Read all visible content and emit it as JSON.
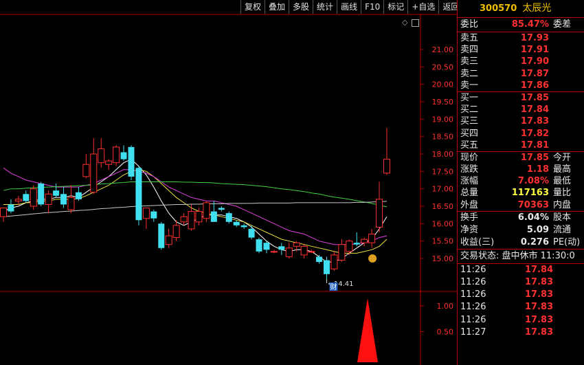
{
  "toolbar": [
    "复权",
    "叠加",
    "多股",
    "统计",
    "画线",
    "F10",
    "标记",
    "+自选",
    "返回"
  ],
  "stock": {
    "code": "300570",
    "name": "太辰光"
  },
  "quote_rows": [
    {
      "label": "委比",
      "value": "85.47%",
      "color": "red",
      "label2": "委差"
    }
  ],
  "ask_rows": [
    {
      "label": "卖五",
      "value": "17.93"
    },
    {
      "label": "卖四",
      "value": "17.91"
    },
    {
      "label": "卖三",
      "value": "17.90"
    },
    {
      "label": "卖二",
      "value": "17.87"
    },
    {
      "label": "卖一",
      "value": "17.86"
    }
  ],
  "bid_rows": [
    {
      "label": "买一",
      "value": "17.85"
    },
    {
      "label": "买二",
      "value": "17.84"
    },
    {
      "label": "买三",
      "value": "17.83"
    },
    {
      "label": "买四",
      "value": "17.82"
    },
    {
      "label": "买五",
      "value": "17.81"
    }
  ],
  "stats_rows": [
    {
      "label": "现价",
      "value": "17.85",
      "color": "red",
      "label2": "今开"
    },
    {
      "label": "涨跌",
      "value": "1.18",
      "color": "red",
      "label2": "最高"
    },
    {
      "label": "涨幅",
      "value": "7.08%",
      "color": "red",
      "label2": "最低"
    },
    {
      "label": "总量",
      "value": "117163",
      "color": "yel",
      "label2": "量比"
    },
    {
      "label": "外盘",
      "value": "70363",
      "color": "red",
      "label2": "内盘"
    }
  ],
  "fin_rows": [
    {
      "label": "换手",
      "value": "6.04%",
      "color": "wht",
      "label2": "股本"
    },
    {
      "label": "净资",
      "value": "5.09",
      "color": "wht",
      "label2": "流通"
    },
    {
      "label": "收益(三)",
      "value": "0.276",
      "color": "wht",
      "label2": "PE(动)"
    }
  ],
  "trade_status": "交易状态: 盘中休市 11:30:0",
  "ticks": [
    {
      "time": "11:26",
      "price": "17.84"
    },
    {
      "time": "11:26",
      "price": "17.83"
    },
    {
      "time": "11:26",
      "price": "17.83"
    },
    {
      "time": "11:26",
      "price": "17.83"
    },
    {
      "time": "11:26",
      "price": "17.83"
    },
    {
      "time": "11:27",
      "price": "17.83"
    }
  ],
  "chart_data": {
    "type": "candlestick",
    "price_axis_ticks": [
      "21.00",
      "20.50",
      "20.00",
      "19.50",
      "19.00",
      "18.50",
      "18.00",
      "17.50",
      "17.00",
      "16.50",
      "16.00",
      "15.50",
      "15.00"
    ],
    "price_range": [
      14.3,
      21.6
    ],
    "volume_axis_ticks": [
      "1.00",
      "0.50"
    ],
    "low_marker": "14.41",
    "finance_badge": "财",
    "candles": [
      {
        "o": 16.2,
        "h": 16.45,
        "l": 16.05,
        "c": 16.45
      },
      {
        "o": 16.55,
        "h": 16.7,
        "l": 16.3,
        "c": 16.35
      },
      {
        "o": 16.65,
        "h": 16.8,
        "l": 16.55,
        "c": 16.7
      },
      {
        "o": 16.85,
        "h": 16.95,
        "l": 16.6,
        "c": 16.65
      },
      {
        "o": 16.5,
        "h": 17.1,
        "l": 16.4,
        "c": 17.0
      },
      {
        "o": 17.15,
        "h": 17.2,
        "l": 16.5,
        "c": 16.55
      },
      {
        "o": 16.55,
        "h": 16.95,
        "l": 16.3,
        "c": 16.85
      },
      {
        "o": 16.95,
        "h": 17.15,
        "l": 16.75,
        "c": 16.8
      },
      {
        "o": 16.85,
        "h": 17.05,
        "l": 16.45,
        "c": 16.55
      },
      {
        "o": 16.4,
        "h": 17.1,
        "l": 16.3,
        "c": 16.75
      },
      {
        "o": 16.9,
        "h": 17.05,
        "l": 16.65,
        "c": 16.7
      },
      {
        "o": 17.35,
        "h": 18.0,
        "l": 17.3,
        "c": 17.7
      },
      {
        "o": 16.9,
        "h": 18.45,
        "l": 16.85,
        "c": 18.0
      },
      {
        "o": 17.75,
        "h": 18.45,
        "l": 17.6,
        "c": 18.15
      },
      {
        "o": 17.7,
        "h": 17.85,
        "l": 17.55,
        "c": 17.8
      },
      {
        "o": 17.75,
        "h": 18.25,
        "l": 17.65,
        "c": 18.2
      },
      {
        "o": 18.05,
        "h": 18.25,
        "l": 17.8,
        "c": 17.85
      },
      {
        "o": 18.2,
        "h": 18.25,
        "l": 17.25,
        "c": 17.35
      },
      {
        "o": 17.6,
        "h": 17.65,
        "l": 15.95,
        "c": 16.1
      },
      {
        "o": 16.15,
        "h": 16.45,
        "l": 15.85,
        "c": 16.45
      },
      {
        "o": 16.35,
        "h": 16.4,
        "l": 16.05,
        "c": 16.15
      },
      {
        "o": 16.0,
        "h": 16.05,
        "l": 15.25,
        "c": 15.3
      },
      {
        "o": 15.4,
        "h": 15.85,
        "l": 15.3,
        "c": 15.65
      },
      {
        "o": 15.6,
        "h": 16.1,
        "l": 15.5,
        "c": 15.95
      },
      {
        "o": 16.05,
        "h": 16.3,
        "l": 15.95,
        "c": 16.2
      },
      {
        "o": 15.85,
        "h": 16.55,
        "l": 15.8,
        "c": 16.35
      },
      {
        "o": 16.05,
        "h": 16.45,
        "l": 15.95,
        "c": 16.35
      },
      {
        "o": 16.15,
        "h": 16.65,
        "l": 16.05,
        "c": 16.6
      },
      {
        "o": 16.35,
        "h": 16.65,
        "l": 16.25,
        "c": 16.05
      },
      {
        "o": 16.45,
        "h": 16.5,
        "l": 16.35,
        "c": 16.4
      },
      {
        "o": 16.3,
        "h": 16.35,
        "l": 16.0,
        "c": 16.05
      },
      {
        "o": 16.05,
        "h": 16.1,
        "l": 15.9,
        "c": 15.95
      },
      {
        "o": 15.95,
        "h": 16.0,
        "l": 15.85,
        "c": 15.9
      },
      {
        "o": 15.85,
        "h": 15.95,
        "l": 15.55,
        "c": 15.6
      },
      {
        "o": 15.55,
        "h": 15.6,
        "l": 15.15,
        "c": 15.2
      },
      {
        "o": 15.45,
        "h": 15.5,
        "l": 15.15,
        "c": 15.25
      },
      {
        "o": 15.2,
        "h": 15.25,
        "l": 15.15,
        "c": 15.2
      },
      {
        "o": 15.35,
        "h": 15.45,
        "l": 15.1,
        "c": 15.25
      },
      {
        "o": 15.05,
        "h": 15.45,
        "l": 15.0,
        "c": 15.3
      },
      {
        "o": 15.35,
        "h": 15.5,
        "l": 15.2,
        "c": 15.45
      },
      {
        "o": 15.1,
        "h": 15.4,
        "l": 15.0,
        "c": 15.35
      },
      {
        "o": 15.2,
        "h": 15.25,
        "l": 15.15,
        "c": 15.2
      },
      {
        "o": 15.05,
        "h": 15.1,
        "l": 14.85,
        "c": 14.9
      },
      {
        "o": 14.95,
        "h": 15.05,
        "l": 14.41,
        "c": 14.55
      },
      {
        "o": 14.7,
        "h": 15.2,
        "l": 14.65,
        "c": 15.1
      },
      {
        "o": 14.95,
        "h": 15.55,
        "l": 14.9,
        "c": 15.4
      },
      {
        "o": 15.2,
        "h": 15.55,
        "l": 15.1,
        "c": 15.5
      },
      {
        "o": 15.45,
        "h": 15.75,
        "l": 15.35,
        "c": 15.4
      },
      {
        "o": 15.45,
        "h": 15.6,
        "l": 15.35,
        "c": 15.55
      },
      {
        "o": 15.45,
        "h": 15.85,
        "l": 15.3,
        "c": 15.7
      },
      {
        "o": 15.9,
        "h": 17.2,
        "l": 15.75,
        "c": 16.7
      },
      {
        "o": 17.45,
        "h": 18.75,
        "l": 17.4,
        "c": 17.85
      }
    ],
    "ma_series": [
      {
        "color": "#ffffff",
        "values": [
          16.35,
          16.45,
          16.5,
          16.6,
          16.65,
          16.7,
          16.7,
          16.75,
          16.75,
          16.8,
          16.75,
          16.9,
          17.05,
          17.2,
          17.35,
          17.55,
          17.75,
          17.85,
          17.65,
          17.4,
          17.05,
          16.65,
          16.3,
          16.05,
          15.95,
          16.05,
          16.15,
          16.25,
          16.25,
          16.25,
          16.2,
          16.15,
          16.05,
          15.9,
          15.7,
          15.5,
          15.35,
          15.25,
          15.2,
          15.25,
          15.25,
          15.2,
          15.05,
          14.9,
          14.9,
          15.0,
          15.15,
          15.3,
          15.45,
          15.55,
          15.85,
          16.2
        ]
      },
      {
        "color": "#f0e040",
        "values": [
          16.55,
          16.55,
          16.55,
          16.6,
          16.6,
          16.65,
          16.65,
          16.7,
          16.7,
          16.7,
          16.72,
          16.8,
          16.9,
          17.0,
          17.1,
          17.25,
          17.4,
          17.5,
          17.55,
          17.5,
          17.35,
          17.15,
          16.95,
          16.75,
          16.6,
          16.45,
          16.35,
          16.3,
          16.25,
          16.2,
          16.15,
          16.1,
          16.05,
          15.95,
          15.85,
          15.75,
          15.65,
          15.55,
          15.5,
          15.45,
          15.4,
          15.35,
          15.3,
          15.25,
          15.2,
          15.15,
          15.15,
          15.15,
          15.2,
          15.25,
          15.35,
          15.55
        ]
      },
      {
        "color": "#e040e0",
        "values": [
          17.6,
          17.45,
          17.35,
          17.25,
          17.2,
          17.15,
          17.1,
          17.05,
          17.05,
          17.05,
          17.05,
          17.1,
          17.15,
          17.25,
          17.35,
          17.45,
          17.55,
          17.55,
          17.5,
          17.45,
          17.35,
          17.2,
          17.05,
          16.95,
          16.85,
          16.75,
          16.7,
          16.65,
          16.65,
          16.6,
          16.55,
          16.5,
          16.4,
          16.3,
          16.2,
          16.1,
          16.0,
          15.9,
          15.8,
          15.75,
          15.7,
          15.6,
          15.5,
          15.45,
          15.4,
          15.4,
          15.4,
          15.42,
          15.45,
          15.5,
          15.6,
          15.65
        ]
      },
      {
        "color": "#40d040",
        "values": [
          16.95,
          17.0,
          17.0,
          17.02,
          17.03,
          17.04,
          17.05,
          17.06,
          17.07,
          17.08,
          17.09,
          17.1,
          17.12,
          17.14,
          17.15,
          17.17,
          17.18,
          17.2,
          17.2,
          17.2,
          17.2,
          17.2,
          17.2,
          17.2,
          17.19,
          17.19,
          17.18,
          17.18,
          17.17,
          17.15,
          17.14,
          17.13,
          17.12,
          17.1,
          17.08,
          17.06,
          17.03,
          17.0,
          16.98,
          16.95,
          16.92,
          16.88,
          16.85,
          16.8,
          16.76,
          16.73,
          16.7,
          16.66,
          16.62,
          16.58,
          16.53,
          16.48
        ]
      },
      {
        "color": "#c8c8c8",
        "values": [
          16.2,
          16.22,
          16.24,
          16.26,
          16.28,
          16.3,
          16.32,
          16.33,
          16.35,
          16.36,
          16.38,
          16.39,
          16.41,
          16.43,
          16.44,
          16.46,
          16.47,
          16.49,
          16.5,
          16.51,
          16.52,
          16.53,
          16.54,
          16.55,
          16.55,
          16.56,
          16.56,
          16.57,
          16.57,
          16.57,
          16.58,
          16.58,
          16.58,
          16.58,
          16.59,
          16.59,
          16.59,
          16.59,
          16.59,
          16.6,
          16.6,
          16.6,
          16.6,
          16.6,
          16.6,
          16.6,
          16.6,
          16.61,
          16.61,
          16.62,
          16.63,
          16.64
        ]
      }
    ],
    "volume_peak": 1.15
  }
}
